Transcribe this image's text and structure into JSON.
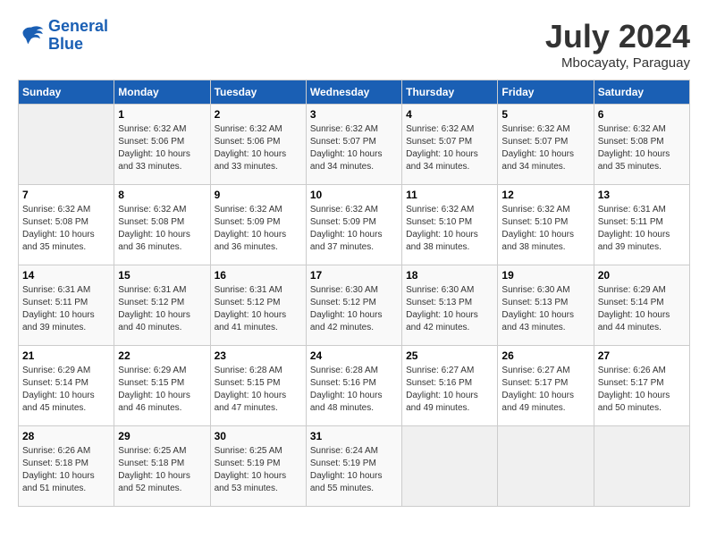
{
  "header": {
    "logo_general": "General",
    "logo_blue": "Blue",
    "month": "July 2024",
    "location": "Mbocayaty, Paraguay"
  },
  "days_of_week": [
    "Sunday",
    "Monday",
    "Tuesday",
    "Wednesday",
    "Thursday",
    "Friday",
    "Saturday"
  ],
  "weeks": [
    [
      {
        "day": "",
        "sunrise": "",
        "sunset": "",
        "daylight": ""
      },
      {
        "day": "1",
        "sunrise": "Sunrise: 6:32 AM",
        "sunset": "Sunset: 5:06 PM",
        "daylight": "Daylight: 10 hours and 33 minutes."
      },
      {
        "day": "2",
        "sunrise": "Sunrise: 6:32 AM",
        "sunset": "Sunset: 5:06 PM",
        "daylight": "Daylight: 10 hours and 33 minutes."
      },
      {
        "day": "3",
        "sunrise": "Sunrise: 6:32 AM",
        "sunset": "Sunset: 5:07 PM",
        "daylight": "Daylight: 10 hours and 34 minutes."
      },
      {
        "day": "4",
        "sunrise": "Sunrise: 6:32 AM",
        "sunset": "Sunset: 5:07 PM",
        "daylight": "Daylight: 10 hours and 34 minutes."
      },
      {
        "day": "5",
        "sunrise": "Sunrise: 6:32 AM",
        "sunset": "Sunset: 5:07 PM",
        "daylight": "Daylight: 10 hours and 34 minutes."
      },
      {
        "day": "6",
        "sunrise": "Sunrise: 6:32 AM",
        "sunset": "Sunset: 5:08 PM",
        "daylight": "Daylight: 10 hours and 35 minutes."
      }
    ],
    [
      {
        "day": "7",
        "sunrise": "Sunrise: 6:32 AM",
        "sunset": "Sunset: 5:08 PM",
        "daylight": "Daylight: 10 hours and 35 minutes."
      },
      {
        "day": "8",
        "sunrise": "Sunrise: 6:32 AM",
        "sunset": "Sunset: 5:08 PM",
        "daylight": "Daylight: 10 hours and 36 minutes."
      },
      {
        "day": "9",
        "sunrise": "Sunrise: 6:32 AM",
        "sunset": "Sunset: 5:09 PM",
        "daylight": "Daylight: 10 hours and 36 minutes."
      },
      {
        "day": "10",
        "sunrise": "Sunrise: 6:32 AM",
        "sunset": "Sunset: 5:09 PM",
        "daylight": "Daylight: 10 hours and 37 minutes."
      },
      {
        "day": "11",
        "sunrise": "Sunrise: 6:32 AM",
        "sunset": "Sunset: 5:10 PM",
        "daylight": "Daylight: 10 hours and 38 minutes."
      },
      {
        "day": "12",
        "sunrise": "Sunrise: 6:32 AM",
        "sunset": "Sunset: 5:10 PM",
        "daylight": "Daylight: 10 hours and 38 minutes."
      },
      {
        "day": "13",
        "sunrise": "Sunrise: 6:31 AM",
        "sunset": "Sunset: 5:11 PM",
        "daylight": "Daylight: 10 hours and 39 minutes."
      }
    ],
    [
      {
        "day": "14",
        "sunrise": "Sunrise: 6:31 AM",
        "sunset": "Sunset: 5:11 PM",
        "daylight": "Daylight: 10 hours and 39 minutes."
      },
      {
        "day": "15",
        "sunrise": "Sunrise: 6:31 AM",
        "sunset": "Sunset: 5:12 PM",
        "daylight": "Daylight: 10 hours and 40 minutes."
      },
      {
        "day": "16",
        "sunrise": "Sunrise: 6:31 AM",
        "sunset": "Sunset: 5:12 PM",
        "daylight": "Daylight: 10 hours and 41 minutes."
      },
      {
        "day": "17",
        "sunrise": "Sunrise: 6:30 AM",
        "sunset": "Sunset: 5:12 PM",
        "daylight": "Daylight: 10 hours and 42 minutes."
      },
      {
        "day": "18",
        "sunrise": "Sunrise: 6:30 AM",
        "sunset": "Sunset: 5:13 PM",
        "daylight": "Daylight: 10 hours and 42 minutes."
      },
      {
        "day": "19",
        "sunrise": "Sunrise: 6:30 AM",
        "sunset": "Sunset: 5:13 PM",
        "daylight": "Daylight: 10 hours and 43 minutes."
      },
      {
        "day": "20",
        "sunrise": "Sunrise: 6:29 AM",
        "sunset": "Sunset: 5:14 PM",
        "daylight": "Daylight: 10 hours and 44 minutes."
      }
    ],
    [
      {
        "day": "21",
        "sunrise": "Sunrise: 6:29 AM",
        "sunset": "Sunset: 5:14 PM",
        "daylight": "Daylight: 10 hours and 45 minutes."
      },
      {
        "day": "22",
        "sunrise": "Sunrise: 6:29 AM",
        "sunset": "Sunset: 5:15 PM",
        "daylight": "Daylight: 10 hours and 46 minutes."
      },
      {
        "day": "23",
        "sunrise": "Sunrise: 6:28 AM",
        "sunset": "Sunset: 5:15 PM",
        "daylight": "Daylight: 10 hours and 47 minutes."
      },
      {
        "day": "24",
        "sunrise": "Sunrise: 6:28 AM",
        "sunset": "Sunset: 5:16 PM",
        "daylight": "Daylight: 10 hours and 48 minutes."
      },
      {
        "day": "25",
        "sunrise": "Sunrise: 6:27 AM",
        "sunset": "Sunset: 5:16 PM",
        "daylight": "Daylight: 10 hours and 49 minutes."
      },
      {
        "day": "26",
        "sunrise": "Sunrise: 6:27 AM",
        "sunset": "Sunset: 5:17 PM",
        "daylight": "Daylight: 10 hours and 49 minutes."
      },
      {
        "day": "27",
        "sunrise": "Sunrise: 6:26 AM",
        "sunset": "Sunset: 5:17 PM",
        "daylight": "Daylight: 10 hours and 50 minutes."
      }
    ],
    [
      {
        "day": "28",
        "sunrise": "Sunrise: 6:26 AM",
        "sunset": "Sunset: 5:18 PM",
        "daylight": "Daylight: 10 hours and 51 minutes."
      },
      {
        "day": "29",
        "sunrise": "Sunrise: 6:25 AM",
        "sunset": "Sunset: 5:18 PM",
        "daylight": "Daylight: 10 hours and 52 minutes."
      },
      {
        "day": "30",
        "sunrise": "Sunrise: 6:25 AM",
        "sunset": "Sunset: 5:19 PM",
        "daylight": "Daylight: 10 hours and 53 minutes."
      },
      {
        "day": "31",
        "sunrise": "Sunrise: 6:24 AM",
        "sunset": "Sunset: 5:19 PM",
        "daylight": "Daylight: 10 hours and 55 minutes."
      },
      {
        "day": "",
        "sunrise": "",
        "sunset": "",
        "daylight": ""
      },
      {
        "day": "",
        "sunrise": "",
        "sunset": "",
        "daylight": ""
      },
      {
        "day": "",
        "sunrise": "",
        "sunset": "",
        "daylight": ""
      }
    ]
  ]
}
